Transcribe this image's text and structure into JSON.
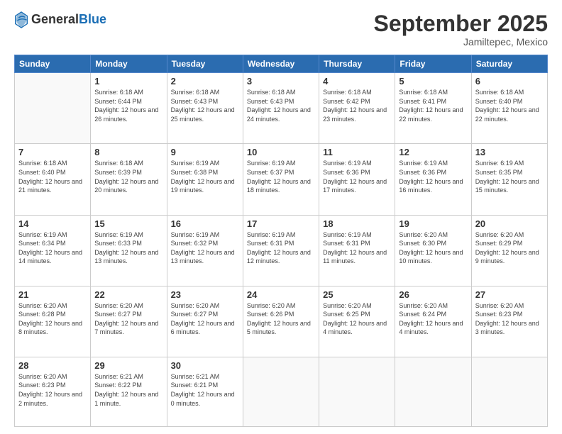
{
  "header": {
    "logo_general": "General",
    "logo_blue": "Blue",
    "month_title": "September 2025",
    "subtitle": "Jamiltepec, Mexico"
  },
  "days": [
    "Sunday",
    "Monday",
    "Tuesday",
    "Wednesday",
    "Thursday",
    "Friday",
    "Saturday"
  ],
  "weeks": [
    [
      {
        "date": "",
        "sunrise": "",
        "sunset": "",
        "daylight": ""
      },
      {
        "date": "1",
        "sunrise": "Sunrise: 6:18 AM",
        "sunset": "Sunset: 6:44 PM",
        "daylight": "Daylight: 12 hours and 26 minutes."
      },
      {
        "date": "2",
        "sunrise": "Sunrise: 6:18 AM",
        "sunset": "Sunset: 6:43 PM",
        "daylight": "Daylight: 12 hours and 25 minutes."
      },
      {
        "date": "3",
        "sunrise": "Sunrise: 6:18 AM",
        "sunset": "Sunset: 6:43 PM",
        "daylight": "Daylight: 12 hours and 24 minutes."
      },
      {
        "date": "4",
        "sunrise": "Sunrise: 6:18 AM",
        "sunset": "Sunset: 6:42 PM",
        "daylight": "Daylight: 12 hours and 23 minutes."
      },
      {
        "date": "5",
        "sunrise": "Sunrise: 6:18 AM",
        "sunset": "Sunset: 6:41 PM",
        "daylight": "Daylight: 12 hours and 22 minutes."
      },
      {
        "date": "6",
        "sunrise": "Sunrise: 6:18 AM",
        "sunset": "Sunset: 6:40 PM",
        "daylight": "Daylight: 12 hours and 22 minutes."
      }
    ],
    [
      {
        "date": "7",
        "sunrise": "Sunrise: 6:18 AM",
        "sunset": "Sunset: 6:40 PM",
        "daylight": "Daylight: 12 hours and 21 minutes."
      },
      {
        "date": "8",
        "sunrise": "Sunrise: 6:18 AM",
        "sunset": "Sunset: 6:39 PM",
        "daylight": "Daylight: 12 hours and 20 minutes."
      },
      {
        "date": "9",
        "sunrise": "Sunrise: 6:19 AM",
        "sunset": "Sunset: 6:38 PM",
        "daylight": "Daylight: 12 hours and 19 minutes."
      },
      {
        "date": "10",
        "sunrise": "Sunrise: 6:19 AM",
        "sunset": "Sunset: 6:37 PM",
        "daylight": "Daylight: 12 hours and 18 minutes."
      },
      {
        "date": "11",
        "sunrise": "Sunrise: 6:19 AM",
        "sunset": "Sunset: 6:36 PM",
        "daylight": "Daylight: 12 hours and 17 minutes."
      },
      {
        "date": "12",
        "sunrise": "Sunrise: 6:19 AM",
        "sunset": "Sunset: 6:36 PM",
        "daylight": "Daylight: 12 hours and 16 minutes."
      },
      {
        "date": "13",
        "sunrise": "Sunrise: 6:19 AM",
        "sunset": "Sunset: 6:35 PM",
        "daylight": "Daylight: 12 hours and 15 minutes."
      }
    ],
    [
      {
        "date": "14",
        "sunrise": "Sunrise: 6:19 AM",
        "sunset": "Sunset: 6:34 PM",
        "daylight": "Daylight: 12 hours and 14 minutes."
      },
      {
        "date": "15",
        "sunrise": "Sunrise: 6:19 AM",
        "sunset": "Sunset: 6:33 PM",
        "daylight": "Daylight: 12 hours and 13 minutes."
      },
      {
        "date": "16",
        "sunrise": "Sunrise: 6:19 AM",
        "sunset": "Sunset: 6:32 PM",
        "daylight": "Daylight: 12 hours and 13 minutes."
      },
      {
        "date": "17",
        "sunrise": "Sunrise: 6:19 AM",
        "sunset": "Sunset: 6:31 PM",
        "daylight": "Daylight: 12 hours and 12 minutes."
      },
      {
        "date": "18",
        "sunrise": "Sunrise: 6:19 AM",
        "sunset": "Sunset: 6:31 PM",
        "daylight": "Daylight: 12 hours and 11 minutes."
      },
      {
        "date": "19",
        "sunrise": "Sunrise: 6:20 AM",
        "sunset": "Sunset: 6:30 PM",
        "daylight": "Daylight: 12 hours and 10 minutes."
      },
      {
        "date": "20",
        "sunrise": "Sunrise: 6:20 AM",
        "sunset": "Sunset: 6:29 PM",
        "daylight": "Daylight: 12 hours and 9 minutes."
      }
    ],
    [
      {
        "date": "21",
        "sunrise": "Sunrise: 6:20 AM",
        "sunset": "Sunset: 6:28 PM",
        "daylight": "Daylight: 12 hours and 8 minutes."
      },
      {
        "date": "22",
        "sunrise": "Sunrise: 6:20 AM",
        "sunset": "Sunset: 6:27 PM",
        "daylight": "Daylight: 12 hours and 7 minutes."
      },
      {
        "date": "23",
        "sunrise": "Sunrise: 6:20 AM",
        "sunset": "Sunset: 6:27 PM",
        "daylight": "Daylight: 12 hours and 6 minutes."
      },
      {
        "date": "24",
        "sunrise": "Sunrise: 6:20 AM",
        "sunset": "Sunset: 6:26 PM",
        "daylight": "Daylight: 12 hours and 5 minutes."
      },
      {
        "date": "25",
        "sunrise": "Sunrise: 6:20 AM",
        "sunset": "Sunset: 6:25 PM",
        "daylight": "Daylight: 12 hours and 4 minutes."
      },
      {
        "date": "26",
        "sunrise": "Sunrise: 6:20 AM",
        "sunset": "Sunset: 6:24 PM",
        "daylight": "Daylight: 12 hours and 4 minutes."
      },
      {
        "date": "27",
        "sunrise": "Sunrise: 6:20 AM",
        "sunset": "Sunset: 6:23 PM",
        "daylight": "Daylight: 12 hours and 3 minutes."
      }
    ],
    [
      {
        "date": "28",
        "sunrise": "Sunrise: 6:20 AM",
        "sunset": "Sunset: 6:23 PM",
        "daylight": "Daylight: 12 hours and 2 minutes."
      },
      {
        "date": "29",
        "sunrise": "Sunrise: 6:21 AM",
        "sunset": "Sunset: 6:22 PM",
        "daylight": "Daylight: 12 hours and 1 minute."
      },
      {
        "date": "30",
        "sunrise": "Sunrise: 6:21 AM",
        "sunset": "Sunset: 6:21 PM",
        "daylight": "Daylight: 12 hours and 0 minutes."
      },
      {
        "date": "",
        "sunrise": "",
        "sunset": "",
        "daylight": ""
      },
      {
        "date": "",
        "sunrise": "",
        "sunset": "",
        "daylight": ""
      },
      {
        "date": "",
        "sunrise": "",
        "sunset": "",
        "daylight": ""
      },
      {
        "date": "",
        "sunrise": "",
        "sunset": "",
        "daylight": ""
      }
    ]
  ]
}
